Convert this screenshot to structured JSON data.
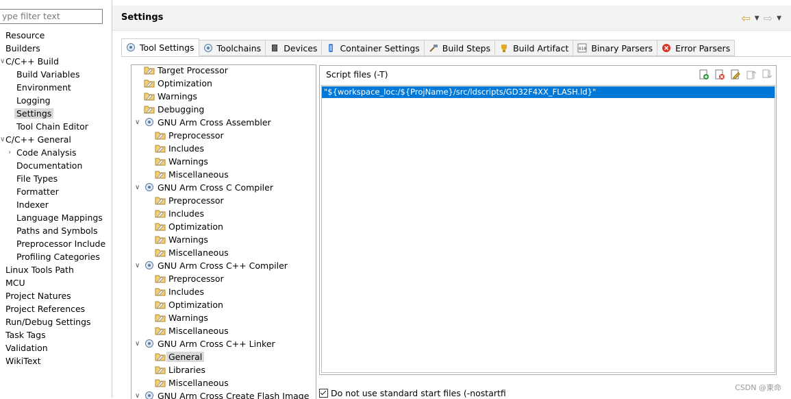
{
  "filter": {
    "placeholder": "ype filter text"
  },
  "nav": [
    {
      "label": "Resource",
      "indent": 0
    },
    {
      "label": "Builders",
      "indent": 0
    },
    {
      "label": "C/C++ Build",
      "indent": 0,
      "expand": "open"
    },
    {
      "label": "Build Variables",
      "indent": 1
    },
    {
      "label": "Environment",
      "indent": 1
    },
    {
      "label": "Logging",
      "indent": 1
    },
    {
      "label": "Settings",
      "indent": 1,
      "selected": true
    },
    {
      "label": "Tool Chain Editor",
      "indent": 1
    },
    {
      "label": "C/C++ General",
      "indent": 0,
      "expand": "open"
    },
    {
      "label": "Code Analysis",
      "indent": 1,
      "expand": "closed"
    },
    {
      "label": "Documentation",
      "indent": 1
    },
    {
      "label": "File Types",
      "indent": 1
    },
    {
      "label": "Formatter",
      "indent": 1
    },
    {
      "label": "Indexer",
      "indent": 1
    },
    {
      "label": "Language Mappings",
      "indent": 1
    },
    {
      "label": "Paths and Symbols",
      "indent": 1
    },
    {
      "label": "Preprocessor Include",
      "indent": 1
    },
    {
      "label": "Profiling Categories",
      "indent": 1
    },
    {
      "label": "Linux Tools Path",
      "indent": 0
    },
    {
      "label": "MCU",
      "indent": 0
    },
    {
      "label": "Project Natures",
      "indent": 0
    },
    {
      "label": "Project References",
      "indent": 0
    },
    {
      "label": "Run/Debug Settings",
      "indent": 0
    },
    {
      "label": "Task Tags",
      "indent": 0
    },
    {
      "label": "Validation",
      "indent": 0
    },
    {
      "label": "WikiText",
      "indent": 0
    }
  ],
  "header": {
    "title": "Settings"
  },
  "tabs": [
    {
      "label": "Tool Settings",
      "icon": "gear-icon",
      "active": true
    },
    {
      "label": "Toolchains",
      "icon": "gear-icon"
    },
    {
      "label": "Devices",
      "icon": "chip-icon"
    },
    {
      "label": "Container Settings",
      "icon": "container-icon"
    },
    {
      "label": "Build Steps",
      "icon": "hammer-icon"
    },
    {
      "label": "Build Artifact",
      "icon": "trophy-icon"
    },
    {
      "label": "Binary Parsers",
      "icon": "binary-icon"
    },
    {
      "label": "Error Parsers",
      "icon": "error-icon"
    }
  ],
  "tree": [
    {
      "label": "Target Processor",
      "level": 0
    },
    {
      "label": "Optimization",
      "level": 0
    },
    {
      "label": "Warnings",
      "level": 0
    },
    {
      "label": "Debugging",
      "level": 0
    },
    {
      "label": "GNU Arm Cross Assembler",
      "level": 0,
      "tool": true
    },
    {
      "label": "Preprocessor",
      "level": 1
    },
    {
      "label": "Includes",
      "level": 1
    },
    {
      "label": "Warnings",
      "level": 1
    },
    {
      "label": "Miscellaneous",
      "level": 1
    },
    {
      "label": "GNU Arm Cross C Compiler",
      "level": 0,
      "tool": true
    },
    {
      "label": "Preprocessor",
      "level": 1
    },
    {
      "label": "Includes",
      "level": 1
    },
    {
      "label": "Optimization",
      "level": 1
    },
    {
      "label": "Warnings",
      "level": 1
    },
    {
      "label": "Miscellaneous",
      "level": 1
    },
    {
      "label": "GNU Arm Cross C++ Compiler",
      "level": 0,
      "tool": true
    },
    {
      "label": "Preprocessor",
      "level": 1
    },
    {
      "label": "Includes",
      "level": 1
    },
    {
      "label": "Optimization",
      "level": 1
    },
    {
      "label": "Warnings",
      "level": 1
    },
    {
      "label": "Miscellaneous",
      "level": 1
    },
    {
      "label": "GNU Arm Cross C++ Linker",
      "level": 0,
      "tool": true
    },
    {
      "label": "General",
      "level": 1,
      "selected": true
    },
    {
      "label": "Libraries",
      "level": 1
    },
    {
      "label": "Miscellaneous",
      "level": 1
    },
    {
      "label": "GNU Arm Cross Create Flash Image",
      "level": 0,
      "tool": true
    }
  ],
  "panel": {
    "title": "Script files (-T)",
    "entry": "\"${workspace_loc:/${ProjName}/src/ldscripts/GD32F4XX_FLASH.ld}\""
  },
  "checkbox": {
    "label": "Do not use standard start files (-nostartfi",
    "checked": true
  },
  "watermark": "CSDN @東命",
  "colors": {
    "selection": "#0078d7",
    "header_bg": "#f3f3f3"
  }
}
